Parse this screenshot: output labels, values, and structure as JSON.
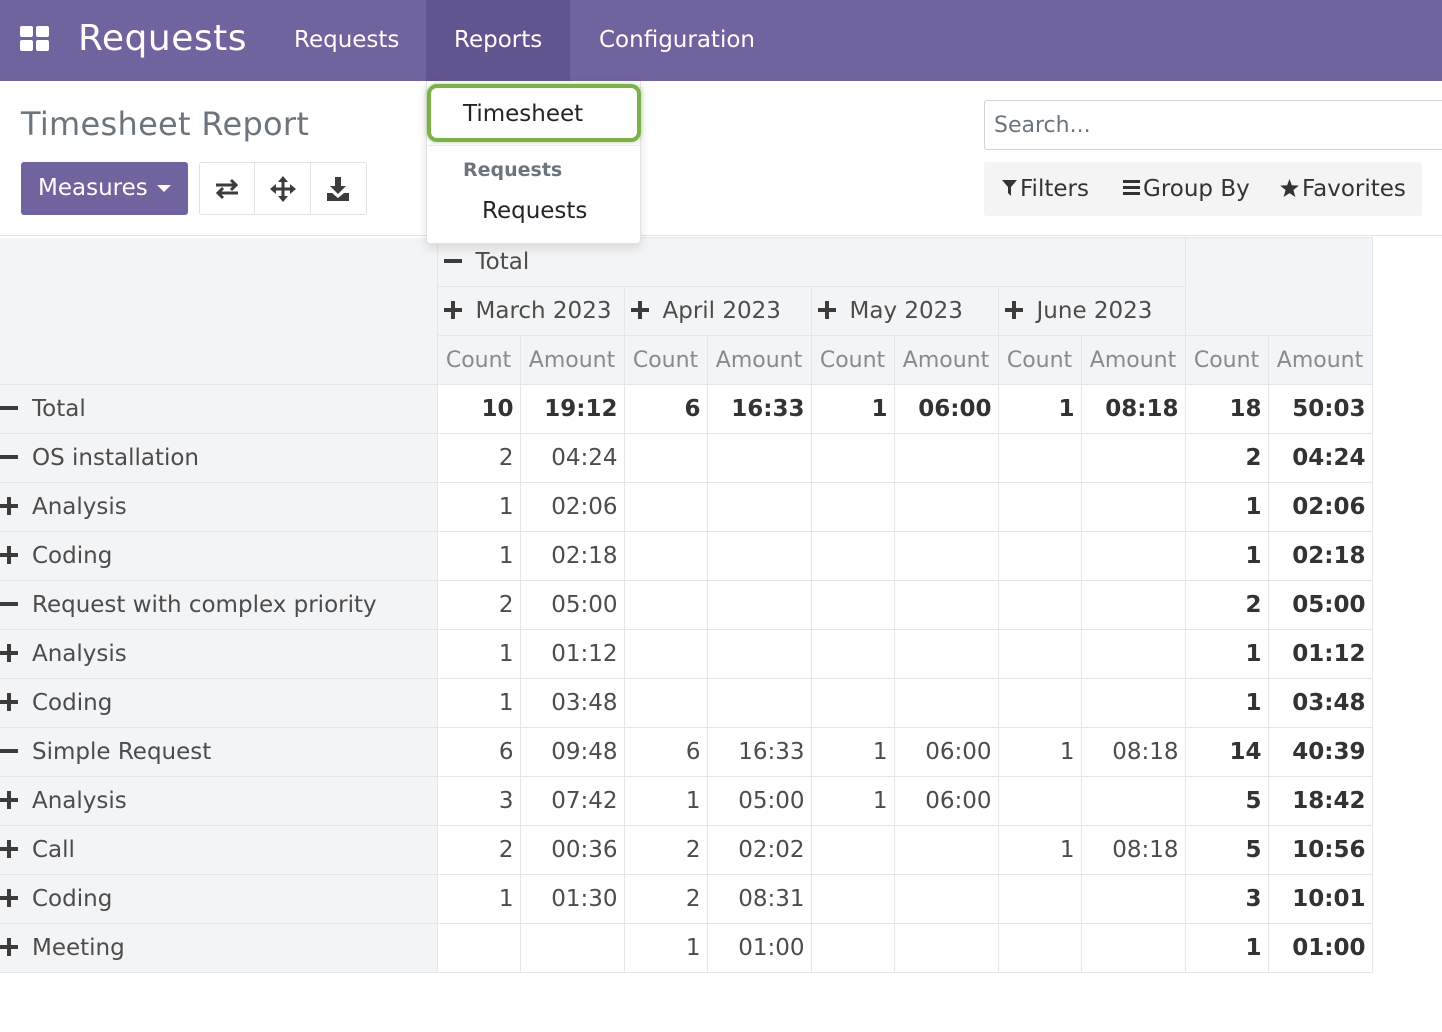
{
  "navbar": {
    "app_title": "Requests",
    "menu": [
      "Requests",
      "Reports",
      "Configuration"
    ],
    "icon": "apps-grid-icon"
  },
  "dropdown": {
    "item_timesheet": "Timesheet",
    "section_header": "Requests",
    "item_requests": "Requests"
  },
  "control_panel": {
    "title": "Timesheet Report",
    "measures_label": "Measures",
    "icons": [
      "flip-axis-icon",
      "expand-all-icon",
      "download-icon"
    ],
    "search_placeholder": "Search...",
    "filters_label": "Filters",
    "group_by_label": "Group By",
    "favorites_label": "Favorites"
  },
  "pivot": {
    "col_total_label": "Total",
    "months": [
      "March 2023",
      "April 2023",
      "May 2023",
      "June 2023"
    ],
    "measures": [
      "Count",
      "Amount"
    ],
    "rows": [
      {
        "label": "Total",
        "level": 0,
        "sign": "minus",
        "bold": true,
        "cells": [
          "10",
          "19:12",
          "6",
          "16:33",
          "1",
          "06:00",
          "1",
          "08:18",
          "18",
          "50:03"
        ]
      },
      {
        "label": "OS installation",
        "level": 1,
        "sign": "minus",
        "cells": [
          "2",
          "04:24",
          "",
          "",
          "",
          "",
          "",
          "",
          "2",
          "04:24"
        ]
      },
      {
        "label": "Analysis",
        "level": 2,
        "sign": "plus",
        "cells": [
          "1",
          "02:06",
          "",
          "",
          "",
          "",
          "",
          "",
          "1",
          "02:06"
        ]
      },
      {
        "label": "Coding",
        "level": 2,
        "sign": "plus",
        "cells": [
          "1",
          "02:18",
          "",
          "",
          "",
          "",
          "",
          "",
          "1",
          "02:18"
        ]
      },
      {
        "label": "Request with complex priority",
        "level": 1,
        "sign": "minus",
        "cells": [
          "2",
          "05:00",
          "",
          "",
          "",
          "",
          "",
          "",
          "2",
          "05:00"
        ]
      },
      {
        "label": "Analysis",
        "level": 2,
        "sign": "plus",
        "cells": [
          "1",
          "01:12",
          "",
          "",
          "",
          "",
          "",
          "",
          "1",
          "01:12"
        ]
      },
      {
        "label": "Coding",
        "level": 2,
        "sign": "plus",
        "cells": [
          "1",
          "03:48",
          "",
          "",
          "",
          "",
          "",
          "",
          "1",
          "03:48"
        ]
      },
      {
        "label": "Simple Request",
        "level": 1,
        "sign": "minus",
        "cells": [
          "6",
          "09:48",
          "6",
          "16:33",
          "1",
          "06:00",
          "1",
          "08:18",
          "14",
          "40:39"
        ]
      },
      {
        "label": "Analysis",
        "level": 2,
        "sign": "plus",
        "cells": [
          "3",
          "07:42",
          "1",
          "05:00",
          "1",
          "06:00",
          "",
          "",
          "5",
          "18:42"
        ]
      },
      {
        "label": "Call",
        "level": 2,
        "sign": "plus",
        "cells": [
          "2",
          "00:36",
          "2",
          "02:02",
          "",
          "",
          "1",
          "08:18",
          "5",
          "10:56"
        ]
      },
      {
        "label": "Coding",
        "level": 2,
        "sign": "plus",
        "cells": [
          "1",
          "01:30",
          "2",
          "08:31",
          "",
          "",
          "",
          "",
          "3",
          "10:01"
        ]
      },
      {
        "label": "Meeting",
        "level": 2,
        "sign": "plus",
        "cells": [
          "",
          "",
          "1",
          "01:00",
          "",
          "",
          "",
          "",
          "1",
          "01:00"
        ]
      }
    ]
  }
}
